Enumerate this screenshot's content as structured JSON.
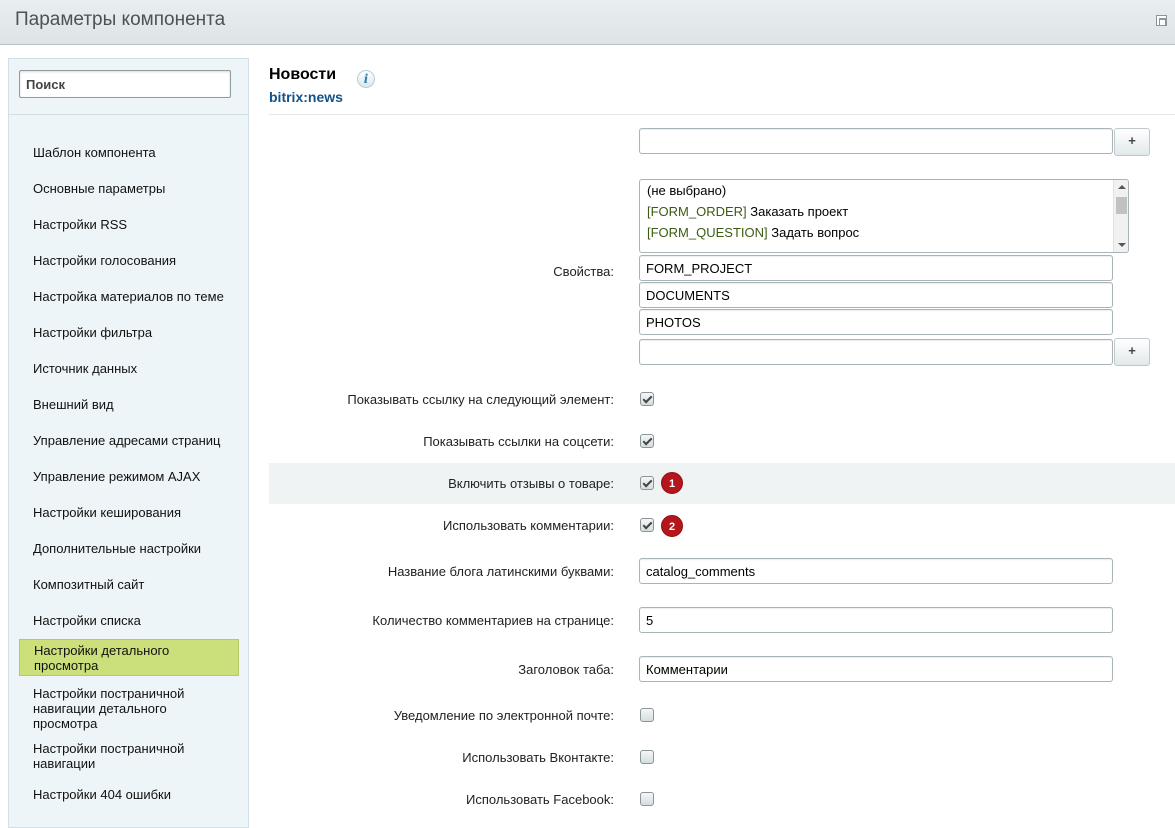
{
  "window": {
    "title": "Параметры компонента"
  },
  "sidebar": {
    "search_placeholder": "Поиск",
    "items": [
      {
        "label": "Шаблон компонента"
      },
      {
        "label": "Основные параметры"
      },
      {
        "label": "Настройки RSS"
      },
      {
        "label": "Настройки голосования"
      },
      {
        "label": "Настройка материалов по теме"
      },
      {
        "label": "Настройки фильтра"
      },
      {
        "label": "Источник данных"
      },
      {
        "label": "Внешний вид"
      },
      {
        "label": "Управление адресами страниц"
      },
      {
        "label": "Управление режимом AJAX"
      },
      {
        "label": "Настройки кеширования"
      },
      {
        "label": "Дополнительные настройки"
      },
      {
        "label": "Композитный сайт"
      },
      {
        "label": "Настройки списка"
      },
      {
        "label": "Настройки детального просмотра",
        "active": true
      },
      {
        "label": "Настройки постраничной навигации детального просмотра"
      },
      {
        "label": "Настройки постраничной навигации"
      },
      {
        "label": "Настройки 404 ошибки"
      }
    ]
  },
  "component": {
    "name": "Новости",
    "code": "bitrix:news",
    "info_icon": "info-icon"
  },
  "form": {
    "top_input": {
      "value": ""
    },
    "plus_label": "+",
    "properties": {
      "label": "Свойства:",
      "options": [
        {
          "code": "",
          "text": "(не выбрано)"
        },
        {
          "code": "[FORM_ORDER]",
          "text": " Заказать проект"
        },
        {
          "code": "[FORM_QUESTION]",
          "text": " Задать вопрос"
        }
      ],
      "values": [
        "FORM_PROJECT",
        "DOCUMENTS",
        "PHOTOS",
        ""
      ]
    },
    "show_next_link": {
      "label": "Показывать ссылку на следующий элемент:",
      "checked": true
    },
    "show_social_links": {
      "label": "Показывать ссылки на соцсети:",
      "checked": true
    },
    "enable_reviews": {
      "label": "Включить отзывы о товаре:",
      "checked": true,
      "badge": "1"
    },
    "use_comments": {
      "label": "Использовать комментарии:",
      "checked": true,
      "badge": "2"
    },
    "blog_name": {
      "label": "Название блога латинскими буквами:",
      "value": "catalog_comments"
    },
    "comments_per_page": {
      "label": "Количество комментариев на странице:",
      "value": "5"
    },
    "tab_title": {
      "label": "Заголовок таба:",
      "value": "Комментарии"
    },
    "email_notify": {
      "label": "Уведомление по электронной почте:",
      "checked": false
    },
    "use_vk": {
      "label": "Использовать Вконтакте:",
      "checked": false
    },
    "use_facebook": {
      "label": "Использовать Facebook:",
      "checked": false
    }
  },
  "colors": {
    "active_nav": "#cbdf7a",
    "badge": "#b4161b",
    "code_link": "#135289"
  }
}
